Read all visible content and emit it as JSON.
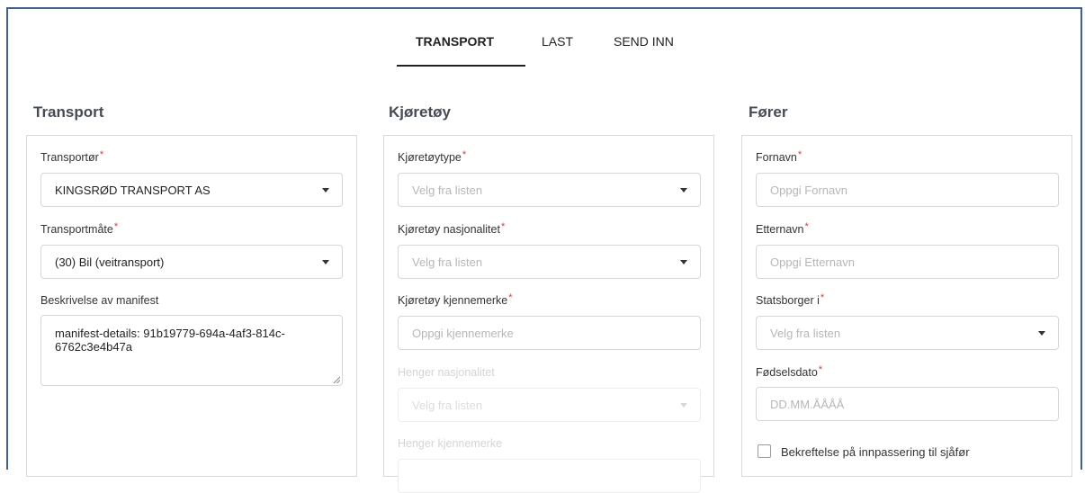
{
  "tabs": {
    "transport": "TRANSPORT",
    "last": "LAST",
    "send_inn": "SEND INN"
  },
  "sections": {
    "transport": "Transport",
    "vehicle": "Kjøretøy",
    "driver": "Fører"
  },
  "transport": {
    "carrier_label": "Transportør",
    "carrier_value": "KINGSRØD TRANSPORT AS",
    "mode_label": "Transportmåte",
    "mode_value": "(30) Bil (veitransport)",
    "manifest_label": "Beskrivelse av manifest",
    "manifest_value": "manifest-details: 91b19779-694a-4af3-814c-6762c3e4b47a"
  },
  "vehicle": {
    "type_label": "Kjøretøytype",
    "type_placeholder": "Velg fra listen",
    "nationality_label": "Kjøretøy nasjonalitet",
    "nationality_placeholder": "Velg fra listen",
    "plate_label": "Kjøretøy kjennemerke",
    "plate_placeholder": "Oppgi kjennemerke",
    "trailer_nationality_label": "Henger nasjonalitet",
    "trailer_nationality_placeholder": "Velg fra listen",
    "trailer_plate_label": "Henger kjennemerke"
  },
  "driver": {
    "first_name_label": "Fornavn",
    "first_name_placeholder": "Oppgi Fornavn",
    "last_name_label": "Etternavn",
    "last_name_placeholder": "Oppgi Etternavn",
    "citizenship_label": "Statsborger i",
    "citizenship_placeholder": "Velg fra listen",
    "dob_label": "Fødselsdato",
    "dob_placeholder": "DD.MM.ÅÅÅÅ",
    "confirm_label": "Bekreftelse på innpassering til sjåfør"
  },
  "required_marker": "*",
  "colors": {
    "frame": "#3f5f9b",
    "required": "#e33333",
    "section_title": "#444c57"
  }
}
